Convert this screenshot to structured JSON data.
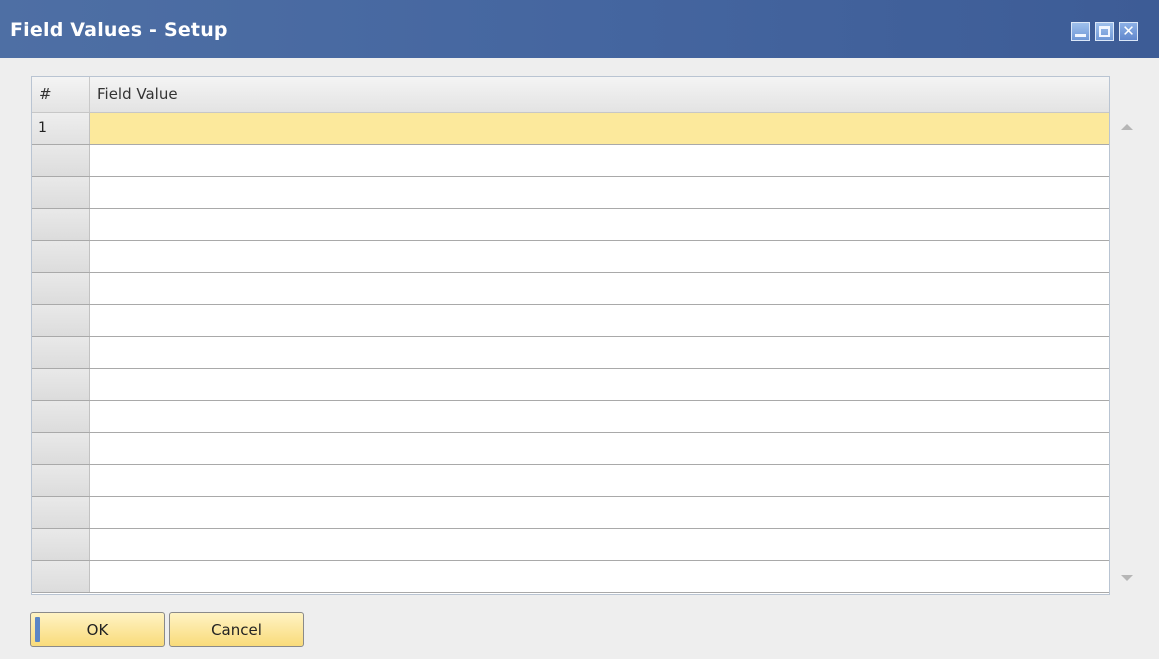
{
  "window": {
    "title": "Field Values - Setup",
    "controls": [
      "minimize",
      "maximize",
      "close"
    ],
    "close_glyph": "✕"
  },
  "grid": {
    "columns": [
      "#",
      "Field Value"
    ],
    "rows": [
      {
        "num": "1",
        "value": ""
      },
      {
        "num": "",
        "value": ""
      },
      {
        "num": "",
        "value": ""
      },
      {
        "num": "",
        "value": ""
      },
      {
        "num": "",
        "value": ""
      },
      {
        "num": "",
        "value": ""
      },
      {
        "num": "",
        "value": ""
      },
      {
        "num": "",
        "value": ""
      },
      {
        "num": "",
        "value": ""
      },
      {
        "num": "",
        "value": ""
      },
      {
        "num": "",
        "value": ""
      },
      {
        "num": "",
        "value": ""
      },
      {
        "num": "",
        "value": ""
      },
      {
        "num": "",
        "value": ""
      },
      {
        "num": "",
        "value": ""
      }
    ],
    "active_row_color": "#fce99c"
  },
  "buttons": {
    "ok_label": "OK",
    "cancel_label": "Cancel"
  }
}
